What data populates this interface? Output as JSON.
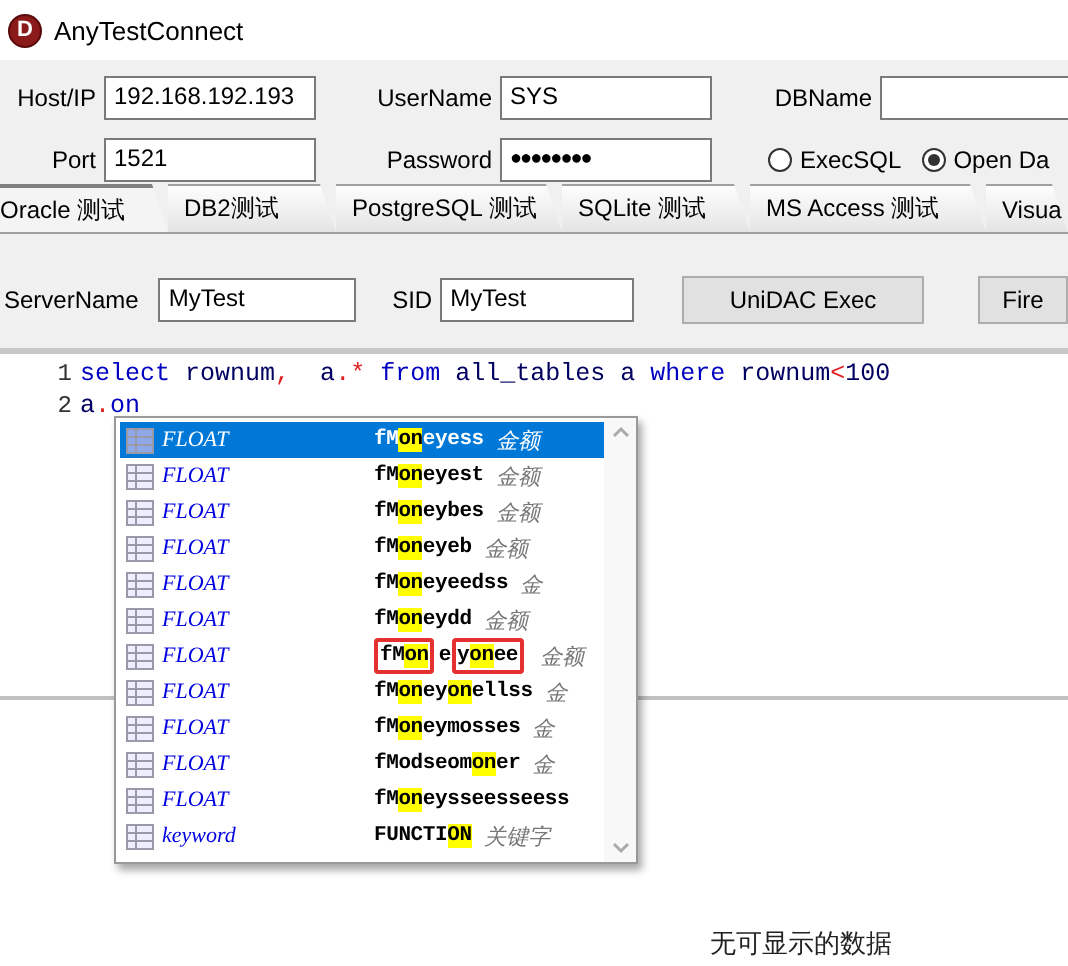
{
  "window": {
    "title": "AnyTestConnect",
    "logo_letter": "D"
  },
  "connection": {
    "host_label": "Host/IP",
    "host": "192.168.192.193",
    "user_label": "UserName",
    "user": "SYS",
    "dbname_label": "DBName",
    "port_label": "Port",
    "port": "1521",
    "password_label": "Password",
    "password": "●●●●●●●●",
    "modes": [
      {
        "label": "ExecSQL",
        "selected": false
      },
      {
        "label": "Open Da",
        "selected": true
      }
    ]
  },
  "tabs": [
    {
      "label": "Oracle 测试",
      "selected": true
    },
    {
      "label": "DB2测试",
      "selected": false
    },
    {
      "label": "PostgreSQL  测试",
      "selected": false
    },
    {
      "label": "SQLite  测试",
      "selected": false
    },
    {
      "label": "MS Access 测试",
      "selected": false
    },
    {
      "label": "Visua",
      "selected": false
    }
  ],
  "oracle_panel": {
    "server_label": "ServerName",
    "server": "MyTest",
    "sid_label": "SID",
    "sid": "MyTest",
    "buttons": [
      "UniDAC Exec",
      "Fire"
    ]
  },
  "editor": {
    "lines": [
      {
        "number": "1",
        "tokens": [
          {
            "text": "select",
            "kind": "keyword"
          },
          {
            "text": " rownum",
            "kind": "ident"
          },
          {
            "text": ",",
            "kind": "symbol"
          },
          {
            "text": "  a",
            "kind": "ident"
          },
          {
            "text": ".*",
            "kind": "symbol"
          },
          {
            "text": " from",
            "kind": "keyword"
          },
          {
            "text": " all_tables a",
            "kind": "ident"
          },
          {
            "text": " where",
            "kind": "keyword"
          },
          {
            "text": " rownum",
            "kind": "ident"
          },
          {
            "text": "<",
            "kind": "symbol"
          },
          {
            "text": "100",
            "kind": "ident"
          }
        ]
      },
      {
        "number": "2",
        "tokens": [
          {
            "text": "a",
            "kind": "ident"
          },
          {
            "text": ".",
            "kind": "symbol"
          },
          {
            "text": "on",
            "kind": "keyword"
          }
        ]
      }
    ]
  },
  "completion": [
    {
      "type": "FLOAT",
      "selected": true,
      "comment": "金额",
      "name": [
        {
          "boxed": false,
          "parts": [
            {
              "text": "fM",
              "highlight": false
            },
            {
              "text": "on",
              "highlight": true
            },
            {
              "text": "eyess",
              "highlight": false
            }
          ]
        }
      ]
    },
    {
      "type": "FLOAT",
      "selected": false,
      "comment": "金额",
      "name": [
        {
          "boxed": false,
          "parts": [
            {
              "text": "fM",
              "highlight": false
            },
            {
              "text": "on",
              "highlight": true
            },
            {
              "text": "eyest",
              "highlight": false
            }
          ]
        }
      ]
    },
    {
      "type": "FLOAT",
      "selected": false,
      "comment": "金额",
      "name": [
        {
          "boxed": false,
          "parts": [
            {
              "text": "fM",
              "highlight": false
            },
            {
              "text": "on",
              "highlight": true
            },
            {
              "text": "eybes",
              "highlight": false
            }
          ]
        }
      ]
    },
    {
      "type": "FLOAT",
      "selected": false,
      "comment": "金额",
      "name": [
        {
          "boxed": false,
          "parts": [
            {
              "text": "fM",
              "highlight": false
            },
            {
              "text": "on",
              "highlight": true
            },
            {
              "text": "eyeb",
              "highlight": false
            }
          ]
        }
      ]
    },
    {
      "type": "FLOAT",
      "selected": false,
      "comment": "金",
      "name": [
        {
          "boxed": false,
          "parts": [
            {
              "text": "fM",
              "highlight": false
            },
            {
              "text": "on",
              "highlight": true
            },
            {
              "text": "eyeedss",
              "highlight": false
            }
          ]
        }
      ]
    },
    {
      "type": "FLOAT",
      "selected": false,
      "comment": "金额",
      "name": [
        {
          "boxed": false,
          "parts": [
            {
              "text": "fM",
              "highlight": false
            },
            {
              "text": "on",
              "highlight": true
            },
            {
              "text": "eydd",
              "highlight": false
            }
          ]
        }
      ]
    },
    {
      "type": "FLOAT",
      "selected": false,
      "comment": "金额",
      "name": [
        {
          "boxed": true,
          "parts": [
            {
              "text": "fM",
              "highlight": false
            },
            {
              "text": "on",
              "highlight": true
            }
          ]
        },
        {
          "boxed": false,
          "parts": [
            {
              "text": "e",
              "highlight": false
            }
          ]
        },
        {
          "boxed": true,
          "parts": [
            {
              "text": "y",
              "highlight": false
            },
            {
              "text": "on",
              "highlight": true
            },
            {
              "text": "ee",
              "highlight": false
            }
          ]
        }
      ]
    },
    {
      "type": "FLOAT",
      "selected": false,
      "comment": "金",
      "name": [
        {
          "boxed": false,
          "parts": [
            {
              "text": "fM",
              "highlight": false
            },
            {
              "text": "on",
              "highlight": true
            },
            {
              "text": "ey",
              "highlight": false
            },
            {
              "text": "on",
              "highlight": true
            },
            {
              "text": "ellss",
              "highlight": false
            }
          ]
        }
      ]
    },
    {
      "type": "FLOAT",
      "selected": false,
      "comment": "金",
      "name": [
        {
          "boxed": false,
          "parts": [
            {
              "text": "fM",
              "highlight": false
            },
            {
              "text": "on",
              "highlight": true
            },
            {
              "text": "eymosses",
              "highlight": false
            }
          ]
        }
      ]
    },
    {
      "type": "FLOAT",
      "selected": false,
      "comment": "金",
      "name": [
        {
          "boxed": false,
          "parts": [
            {
              "text": "fModseom",
              "highlight": false
            },
            {
              "text": "on",
              "highlight": true
            },
            {
              "text": "er",
              "highlight": false
            }
          ]
        }
      ]
    },
    {
      "type": "FLOAT",
      "selected": false,
      "name": [
        {
          "boxed": false,
          "parts": [
            {
              "text": "fM",
              "highlight": false
            },
            {
              "text": "on",
              "highlight": true
            },
            {
              "text": "eysseesseess",
              "highlight": false
            }
          ]
        }
      ]
    },
    {
      "type": "keyword",
      "selected": false,
      "comment": "关键字",
      "name": [
        {
          "boxed": false,
          "parts": [
            {
              "text": "FUNCTI",
              "highlight": false
            },
            {
              "text": "ON",
              "highlight": true
            }
          ]
        }
      ]
    }
  ],
  "results": {
    "empty_message": "无可显示的数据"
  }
}
